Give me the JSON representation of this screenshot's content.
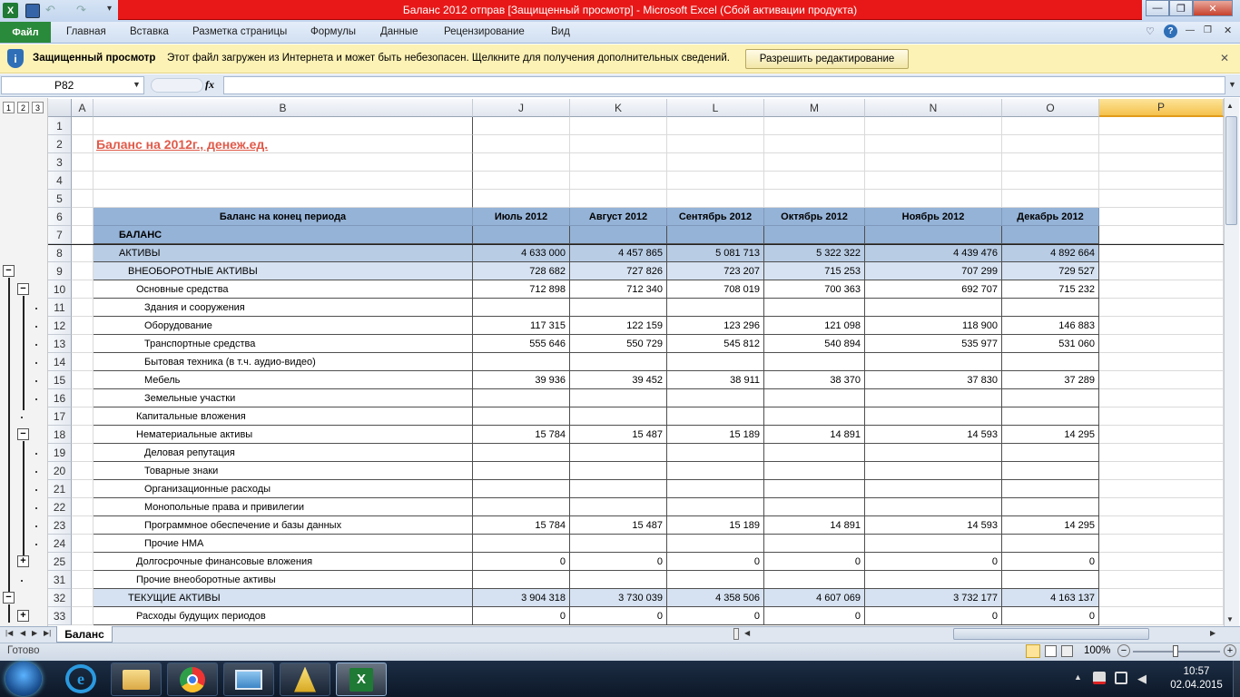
{
  "window": {
    "title": "Баланс 2012 отправ  [Защищенный просмотр]  -  Microsoft Excel (Сбой активации продукта)",
    "controls": [
      "—",
      "❐",
      "✕"
    ]
  },
  "ribbon": {
    "file_tab": "Файл",
    "tabs": [
      "Главная",
      "Вставка",
      "Разметка страницы",
      "Формулы",
      "Данные",
      "Рецензирование",
      "Вид"
    ]
  },
  "protected_view": {
    "label": "Защищенный просмотр",
    "message": "Этот файл загружен из Интернета и может быть небезопасен. Щелкните для получения дополнительных сведений.",
    "enable_button": "Разрешить редактирование",
    "close": "✕"
  },
  "formula_bar": {
    "name_box": "P82",
    "fx": "fx",
    "formula": ""
  },
  "outline_levels": [
    "1",
    "2",
    "3"
  ],
  "columns": [
    "A",
    "B",
    "J",
    "K",
    "L",
    "M",
    "N",
    "O",
    "P"
  ],
  "sheet_title": "Баланс на 2012г., денеж.ед.",
  "table_header": {
    "label": "Баланс на конец периода",
    "months": [
      "Июль 2012",
      "Август 2012",
      "Сентябрь 2012",
      "Октябрь 2012",
      "Ноябрь 2012",
      "Декабрь 2012"
    ]
  },
  "rows": [
    {
      "n": "1",
      "label": "",
      "values": [
        "",
        "",
        "",
        "",
        "",
        ""
      ]
    },
    {
      "n": "2",
      "label": "",
      "values": [
        "",
        "",
        "",
        "",
        "",
        ""
      ]
    },
    {
      "n": "3",
      "label": "",
      "values": [
        "",
        "",
        "",
        "",
        "",
        ""
      ]
    },
    {
      "n": "4",
      "label": "",
      "values": [
        "",
        "",
        "",
        "",
        "",
        ""
      ]
    },
    {
      "n": "5",
      "label": "",
      "values": [
        "",
        "",
        "",
        "",
        "",
        ""
      ]
    },
    {
      "n": "6",
      "label": "",
      "values": [
        "",
        "",
        "",
        "",
        "",
        ""
      ]
    },
    {
      "n": "7",
      "label": "БАЛАНС",
      "values": [
        "",
        "",
        "",
        "",
        "",
        ""
      ]
    },
    {
      "n": "8",
      "label": "АКТИВЫ",
      "values": [
        "4 633 000",
        "4 457 865",
        "5 081 713",
        "5 322 322",
        "4 439 476",
        "4 892 664"
      ]
    },
    {
      "n": "9",
      "label": "ВНЕОБОРОТНЫЕ АКТИВЫ",
      "values": [
        "728 682",
        "727 826",
        "723 207",
        "715 253",
        "707 299",
        "729 527"
      ]
    },
    {
      "n": "10",
      "label": "Основные средства",
      "values": [
        "712 898",
        "712 340",
        "708 019",
        "700 363",
        "692 707",
        "715 232"
      ]
    },
    {
      "n": "11",
      "label": "Здания и сооружения",
      "values": [
        "",
        "",
        "",
        "",
        "",
        ""
      ]
    },
    {
      "n": "12",
      "label": "Оборудование",
      "values": [
        "117 315",
        "122 159",
        "123 296",
        "121 098",
        "118 900",
        "146 883"
      ]
    },
    {
      "n": "13",
      "label": "Транспортные средства",
      "values": [
        "555 646",
        "550 729",
        "545 812",
        "540 894",
        "535 977",
        "531 060"
      ]
    },
    {
      "n": "14",
      "label": "Бытовая техника (в т.ч. аудио-видео)",
      "values": [
        "",
        "",
        "",
        "",
        "",
        ""
      ]
    },
    {
      "n": "15",
      "label": "Мебель",
      "values": [
        "39 936",
        "39 452",
        "38 911",
        "38 370",
        "37 830",
        "37 289"
      ]
    },
    {
      "n": "16",
      "label": "Земельные участки",
      "values": [
        "",
        "",
        "",
        "",
        "",
        ""
      ]
    },
    {
      "n": "17",
      "label": "Капитальные вложения",
      "values": [
        "",
        "",
        "",
        "",
        "",
        ""
      ]
    },
    {
      "n": "18",
      "label": "Нематериальные активы",
      "values": [
        "15 784",
        "15 487",
        "15 189",
        "14 891",
        "14 593",
        "14 295"
      ]
    },
    {
      "n": "19",
      "label": "Деловая репутация",
      "values": [
        "",
        "",
        "",
        "",
        "",
        ""
      ]
    },
    {
      "n": "20",
      "label": "Товарные знаки",
      "values": [
        "",
        "",
        "",
        "",
        "",
        ""
      ]
    },
    {
      "n": "21",
      "label": "Организационные расходы",
      "values": [
        "",
        "",
        "",
        "",
        "",
        ""
      ]
    },
    {
      "n": "22",
      "label": "Монопольные права и привилегии",
      "values": [
        "",
        "",
        "",
        "",
        "",
        ""
      ]
    },
    {
      "n": "23",
      "label": "Программное обеспечение и базы данных",
      "values": [
        "15 784",
        "15 487",
        "15 189",
        "14 891",
        "14 593",
        "14 295"
      ]
    },
    {
      "n": "24",
      "label": "Прочие НМА",
      "values": [
        "",
        "",
        "",
        "",
        "",
        ""
      ]
    },
    {
      "n": "25",
      "label": "Долгосрочные финансовые вложения",
      "values": [
        "0",
        "0",
        "0",
        "0",
        "0",
        "0"
      ]
    },
    {
      "n": "31",
      "label": "Прочие внеоборотные активы",
      "values": [
        "",
        "",
        "",
        "",
        "",
        ""
      ]
    },
    {
      "n": "32",
      "label": "ТЕКУЩИЕ АКТИВЫ",
      "values": [
        "3 904 318",
        "3 730 039",
        "4 358 506",
        "4 607 069",
        "3 732 177",
        "4 163 137"
      ]
    },
    {
      "n": "33",
      "label": "Расходы будущих периодов",
      "values": [
        "0",
        "0",
        "0",
        "0",
        "0",
        "0"
      ]
    }
  ],
  "sheet_tabs": [
    "Баланс"
  ],
  "status": {
    "ready": "Готово",
    "zoom": "100%"
  },
  "taskbar": {
    "time": "10:57",
    "date": "02.04.2015"
  },
  "colors": {
    "title_bar_error": "#e81818",
    "file_tab": "#2a8a3b",
    "header_fill": "#95b3d7",
    "assets_fill": "#b8cce4",
    "section_fill": "#d6e2f1",
    "sheet_title": "#e05a4a",
    "protected_bar": "#fdf2b5"
  }
}
